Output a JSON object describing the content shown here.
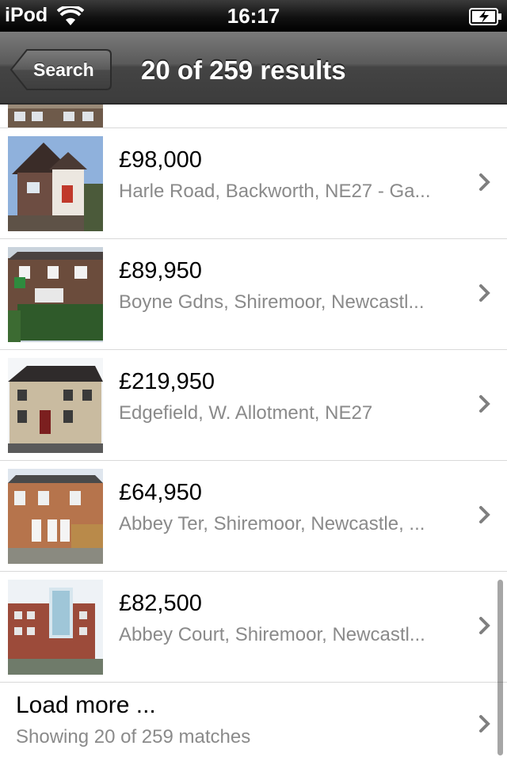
{
  "status_bar": {
    "carrier": "iPod",
    "time": "16:17",
    "wifi_icon": "wifi-icon",
    "battery_icon": "battery-charging-icon"
  },
  "nav": {
    "back_label": "Search",
    "title": "20 of 259 results"
  },
  "results": [
    {
      "price": "£98,000",
      "address": "Harle Road, Backworth, NE27 - Ga..."
    },
    {
      "price": "£89,950",
      "address": "Boyne Gdns, Shiremoor, Newcastl..."
    },
    {
      "price": "£219,950",
      "address": "Edgefield, W. Allotment, NE27"
    },
    {
      "price": "£64,950",
      "address": "Abbey Ter, Shiremoor, Newcastle, ..."
    },
    {
      "price": "£82,500",
      "address": "Abbey Court, Shiremoor, Newcastl..."
    }
  ],
  "load_more": {
    "title": "Load more ...",
    "subtitle": "Showing 20 of 259 matches"
  },
  "colors": {
    "accent_text": "#8a8a8a",
    "separator": "#d9d9d9",
    "navbar": "#4a4a4a"
  }
}
